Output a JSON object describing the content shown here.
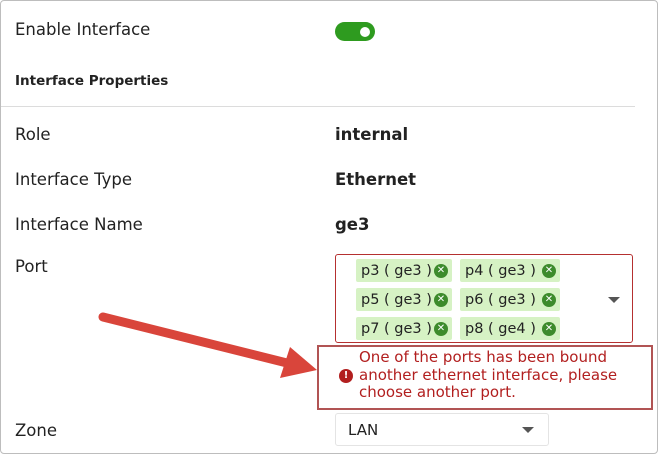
{
  "form": {
    "enable_interface_label": "Enable Interface",
    "enable_interface_on": true,
    "section_title": "Interface Properties",
    "role_label": "Role",
    "role_value": "internal",
    "type_label": "Interface Type",
    "type_value": "Ethernet",
    "name_label": "Interface Name",
    "name_value": "ge3",
    "port_label": "Port",
    "ports": [
      "p3 ( ge3 )",
      "p4 ( ge3 )",
      "p5 ( ge3 )",
      "p6 ( ge3 )",
      "p7 ( ge3 )",
      "p8 ( ge4 )"
    ],
    "error_message": "One of the ports has been bound another ethernet interface, please choose another port.",
    "zone_label": "Zone",
    "zone_value": "LAN"
  },
  "colors": {
    "toggle_on": "#2e9b1f",
    "chip_bg": "#d6f2c4",
    "error": "#b21f1f",
    "annotation_arrow": "#d9453b"
  },
  "icons": {
    "chip_remove": "close-circle-icon",
    "error": "exclamation-circle-icon",
    "dropdown": "chevron-down-icon",
    "annotation": "red-arrow-annotation"
  }
}
